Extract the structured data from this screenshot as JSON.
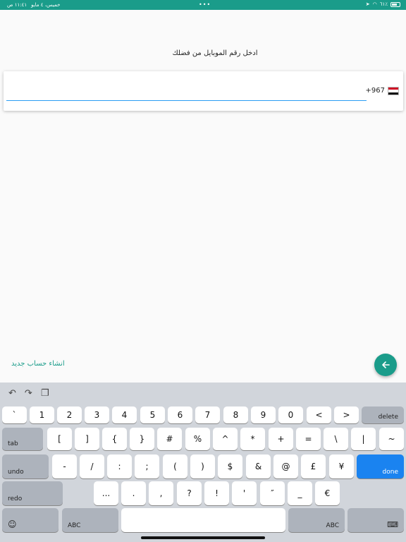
{
  "status_bar": {
    "time": "١١:٤١ ص",
    "date": "خميس، ٤ مايو",
    "center_dots": "•••",
    "battery": "٦١٪"
  },
  "prompt": "ادخل رقم الموبايل من فضلك",
  "phone": {
    "country_code": "+967",
    "flag": "yemen-flag",
    "value": ""
  },
  "actions": {
    "new_account": "انشاء حساب جديد",
    "next_icon": "arrow-left-icon"
  },
  "keyboard": {
    "toolbar": [
      "undo-icon",
      "redo-icon",
      "clipboard-icon"
    ],
    "row1": [
      "`",
      "1",
      "2",
      "3",
      "4",
      "5",
      "6",
      "7",
      "8",
      "9",
      "0",
      "<",
      ">"
    ],
    "delete": "delete",
    "tab": "tab",
    "row2": [
      "[",
      "]",
      "{",
      "}",
      "#",
      "%",
      "^",
      "*",
      "+",
      "=",
      "\\",
      "|",
      "~"
    ],
    "undo": "undo",
    "row3": [
      "-",
      "/",
      ":",
      ";",
      "(",
      ")",
      "$",
      "&",
      "@",
      "£",
      "¥"
    ],
    "done": "done",
    "redo": "redo",
    "row4": [
      "...",
      ".",
      ",",
      "?",
      "!",
      "'",
      "″",
      "_",
      "€"
    ],
    "emoji": "☺",
    "abc_left": "ABC",
    "abc_right": "ABC",
    "hide_icon": "keyboard-hide-icon",
    "accent": "#1a9c8a",
    "done_color": "#1a83f0"
  }
}
